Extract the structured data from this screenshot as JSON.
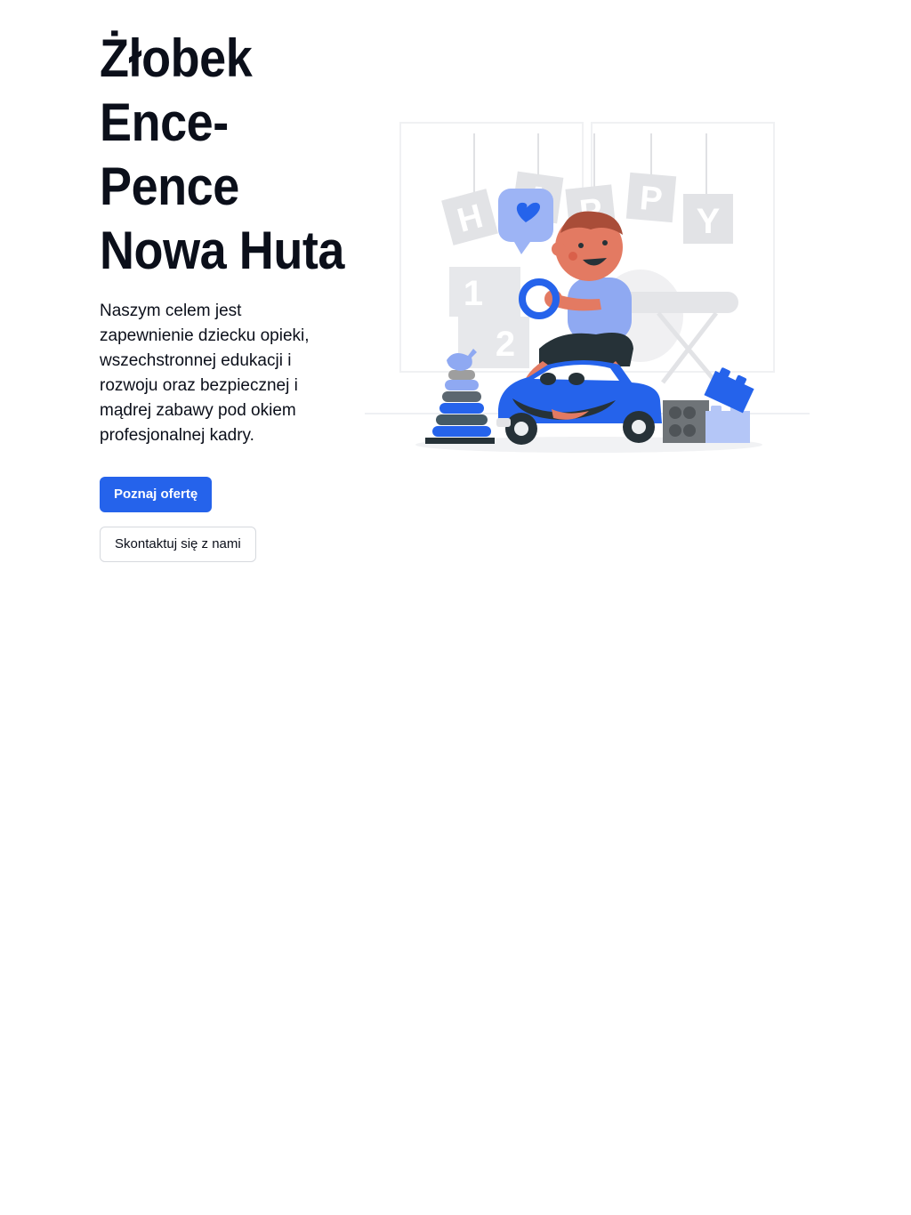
{
  "hero": {
    "title": "Żłobek Ence-Pence Nowa Huta",
    "description": "Naszym celem jest zapewnienie dziecku opieki, wszechstronnej edukacji i rozwoju oraz bezpiecznej i mądrej zabawy pod okiem profesjonalnej kadry.",
    "primary_button": "Poznaj ofertę",
    "secondary_button": "Skontaktuj się z nami"
  },
  "illustration": {
    "subject": "baby-on-toy-car-illustration",
    "blocks_text": [
      "H",
      "A",
      "P",
      "P",
      "Y"
    ],
    "number_blocks": [
      "1",
      "2"
    ]
  },
  "colors": {
    "accent": "#2563eb",
    "accent_light": "#8fa9f2",
    "title_text": "#0b0f1a",
    "skin": "#e37a62"
  }
}
